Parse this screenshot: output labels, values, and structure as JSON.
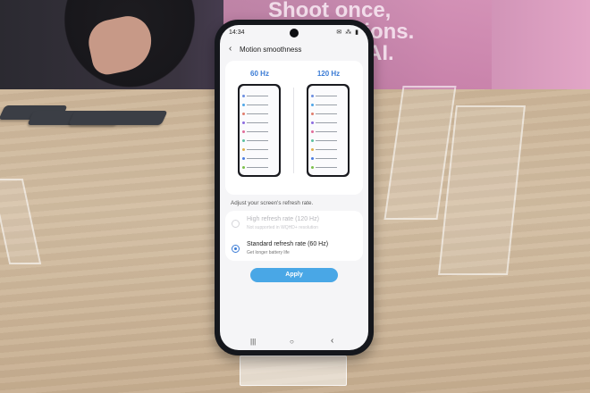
{
  "banner": {
    "line1": "Shoot once,",
    "line2": "options.",
    "line3": "AI."
  },
  "status": {
    "time": "14:34",
    "icons": "✉ ⁂ ▮"
  },
  "header": {
    "title": "Motion smoothness"
  },
  "preview": {
    "left_label": "60 Hz",
    "right_label": "120 Hz"
  },
  "hint": "Adjust your screen's refresh rate.",
  "options": [
    {
      "title": "High refresh rate (120 Hz)",
      "subtitle": "Not supported in WQHD+ resolution",
      "selected": false,
      "enabled": false
    },
    {
      "title": "Standard refresh rate (60 Hz)",
      "subtitle": "Get longer battery life",
      "selected": true,
      "enabled": true
    }
  ],
  "apply_label": "Apply",
  "nav": {
    "recents": "|||",
    "home": "○",
    "back": "‹"
  },
  "colors": {
    "accent": "#3a7bd5",
    "apply": "#49a7e6"
  }
}
